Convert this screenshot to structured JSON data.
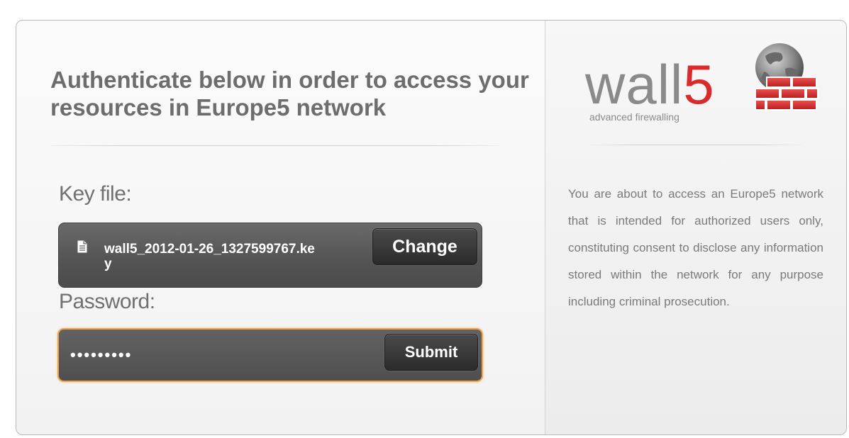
{
  "auth": {
    "headline": "Authenticate below in order to access your resources in Europe5 network",
    "key_label": "Key file:",
    "key_filename": "wall5_2012-01-26_1327599767.key",
    "change_label": "Change",
    "password_label": "Password:",
    "password_value": "•••••••••",
    "submit_label": "Submit"
  },
  "brand": {
    "logo_word": "wall",
    "logo_number": "5",
    "tagline": "advanced firewalling"
  },
  "notice": {
    "text": "You are about to access an Europe5 network that is intended for authorized users only, constituting consent to disclose any information stored within the network for any purpose including criminal prosecution."
  },
  "colors": {
    "accent_focus": "#f0a24a",
    "logo_red": "#d92b2b",
    "panel_dark": "#555555"
  },
  "icons": {
    "file": "file-icon",
    "logo_graphic": "globe-brick-wall-icon"
  }
}
